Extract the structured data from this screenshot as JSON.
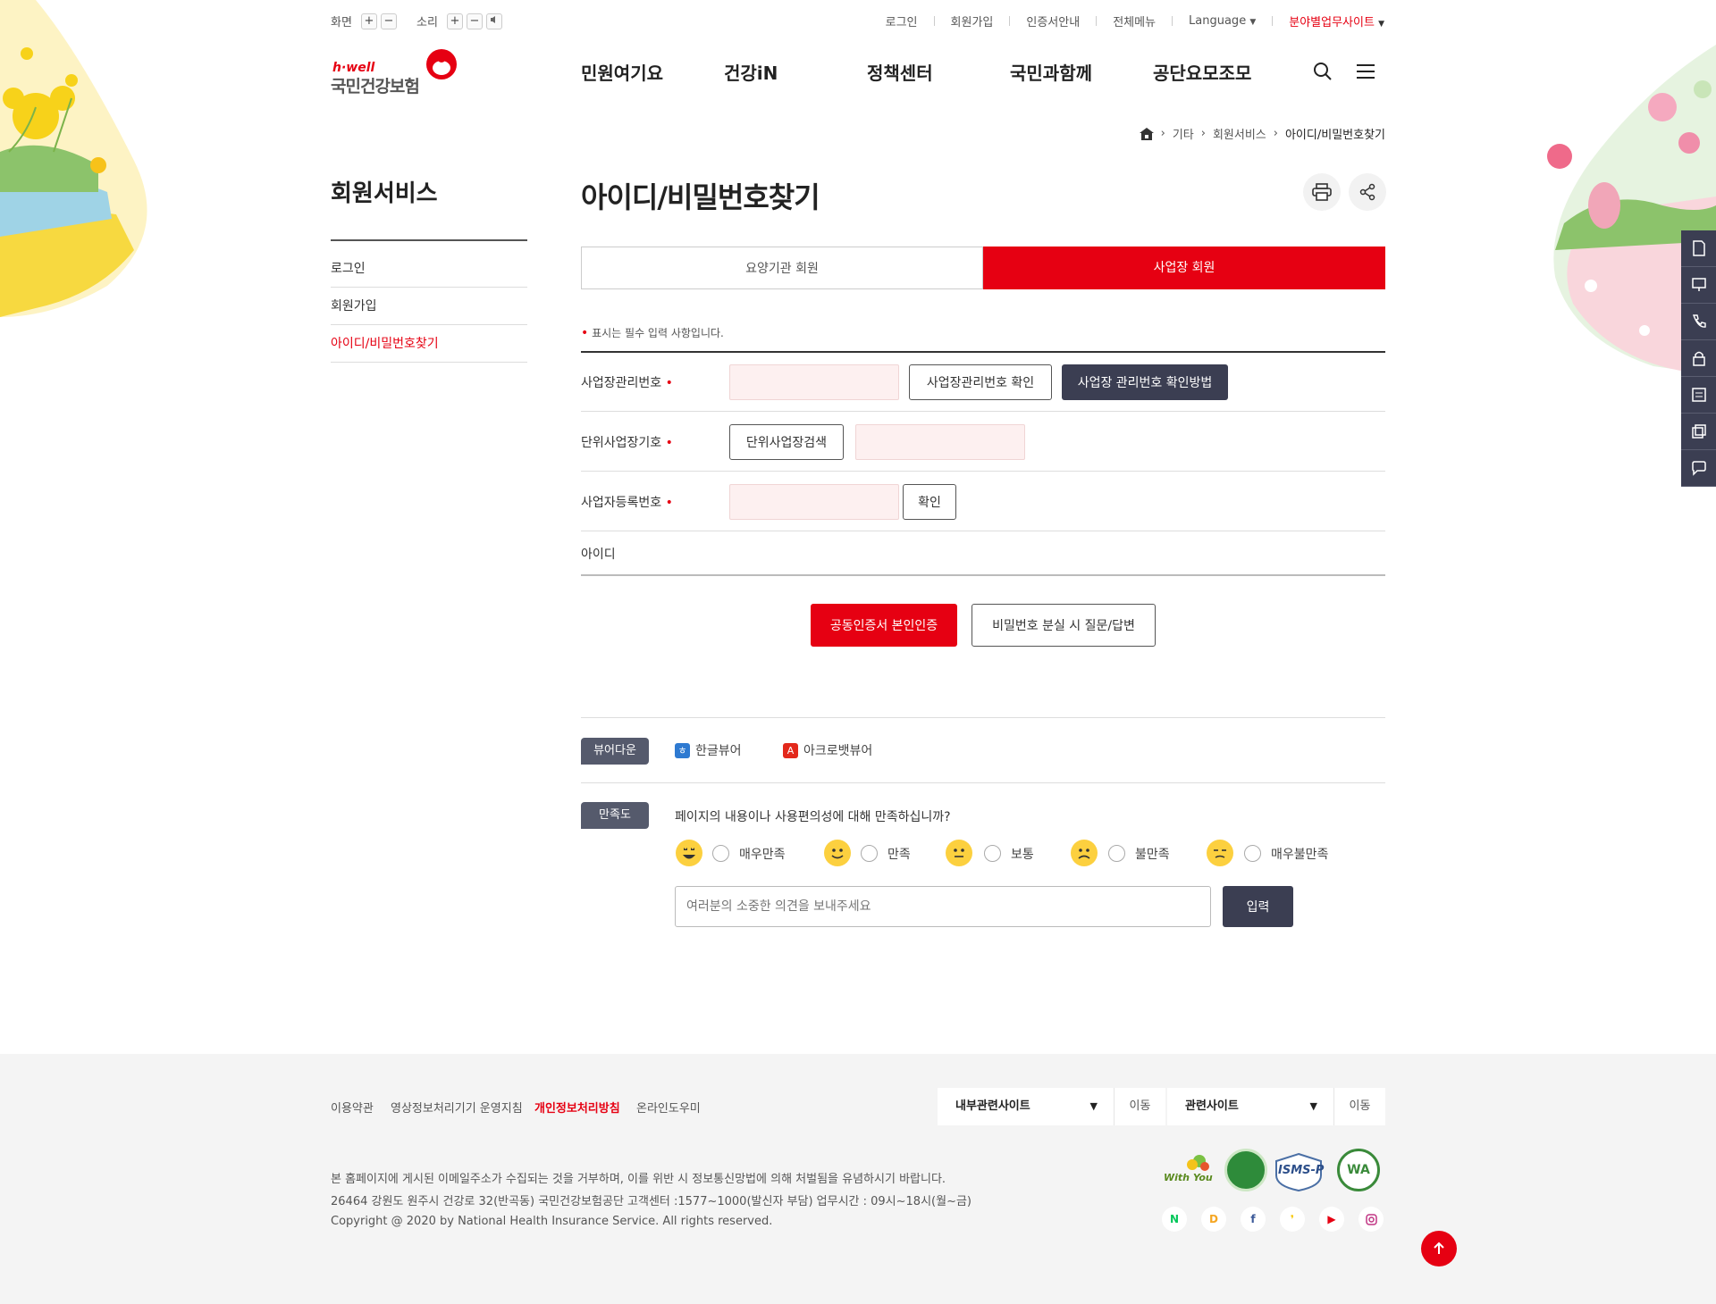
{
  "util": {
    "screen_label": "화면",
    "sound_label": "소리",
    "plus": "+",
    "minus": "−"
  },
  "toplinks": {
    "login": "로그인",
    "join": "회원가입",
    "cert": "인증서안내",
    "allmenu": "전체메뉴",
    "language": "Language",
    "field_sites": "분야별업무사이트"
  },
  "logo": {
    "brand": "h·well",
    "name": "국민건강보험"
  },
  "gnb": [
    "민원여기요",
    "건강iN",
    "정책센터",
    "국민과함께",
    "공단요모조모"
  ],
  "breadcrumb": {
    "level1": "기타",
    "level2": "회원서비스",
    "level3": "아이디/비밀번호찾기"
  },
  "lnb": {
    "title": "회원서비스",
    "items": [
      "로그인",
      "회원가입",
      "아이디/비밀번호찾기"
    ]
  },
  "page": {
    "title": "아이디/비밀번호찾기"
  },
  "tabs": [
    "요양기관 회원",
    "사업장 회원"
  ],
  "form": {
    "required_note": "표시는 필수 입력 사항입니다.",
    "row1_label": "사업장관리번호",
    "row1_btn1": "사업장관리번호 확인",
    "row1_btn2": "사업장 관리번호 확인방법",
    "row2_label": "단위사업장기호",
    "row2_btn": "단위사업장검색",
    "row3_label": "사업자등록번호",
    "row3_btn": "확인",
    "row4_label": "아이디",
    "cert_btn": "공동인증서 본인인증",
    "qa_btn": "비밀번호 분실 시 질문/답변"
  },
  "viewer": {
    "label": "뷰어다운",
    "hwp": "한글뷰어",
    "acrobat": "아크로뱃뷰어"
  },
  "survey": {
    "label": "만족도",
    "question": "페이지의 내용이나 사용편의성에 대해 만족하십니까?",
    "options": [
      "매우만족",
      "만족",
      "보통",
      "불만족",
      "매우불만족"
    ],
    "placeholder": "여러분의 소중한 의견을 보내주세요",
    "submit": "입력"
  },
  "footer": {
    "links": [
      "이용약관",
      "영상정보처리기기 운영지침",
      "개인정보처리방침",
      "온라인도우미"
    ],
    "select1": "내부관련사이트",
    "select2": "관련사이트",
    "go": "이동",
    "line1": "본 홈페이지에 게시된 이메일주소가 수집되는 것을 거부하며, 이를 위반 시 정보통신망법에 의해 처벌됨을 유념하시기 바랍니다.",
    "line2": "26464 강원도 원주시 건강로 32(반곡동) 국민건강보험공단 고객센터 :1577~1000(발신자 부담) 업무시간 : 09시~18시(월~금)",
    "line3": "Copyright @ 2020 by National Health Insurance Service. All rights reserved.",
    "cert_withyou": "With You",
    "cert_isms": "ISMS-P",
    "cert_wa": "WA"
  },
  "colors": {
    "accent": "#e60012",
    "dark": "#3b3e52"
  }
}
